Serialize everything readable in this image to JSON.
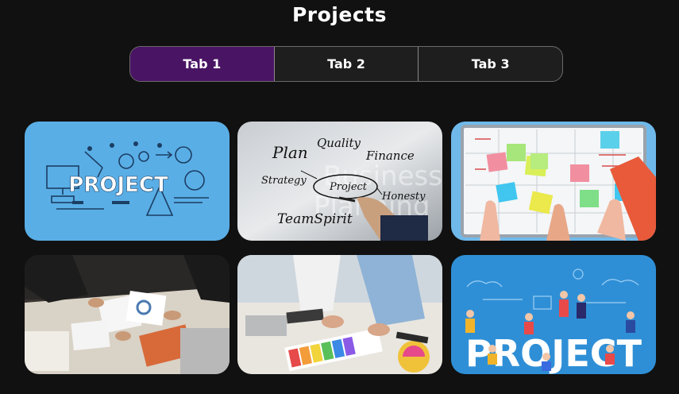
{
  "page": {
    "title": "Projects"
  },
  "tabs": [
    {
      "label": "Tab 1",
      "active": true
    },
    {
      "label": "Tab 2",
      "active": false
    },
    {
      "label": "Tab 3",
      "active": false
    }
  ],
  "cards": [
    {
      "caption": "PROJECT"
    },
    {
      "words": [
        "Plan",
        "Quality",
        "Finance",
        "Strategy",
        "Project",
        "Honesty",
        "TeamSpirit"
      ]
    },
    {
      "caption": ""
    },
    {
      "caption": ""
    },
    {
      "caption": ""
    },
    {
      "caption": "PROJECT"
    }
  ],
  "colors": {
    "accent": "#4a1464",
    "background": "#111111"
  }
}
